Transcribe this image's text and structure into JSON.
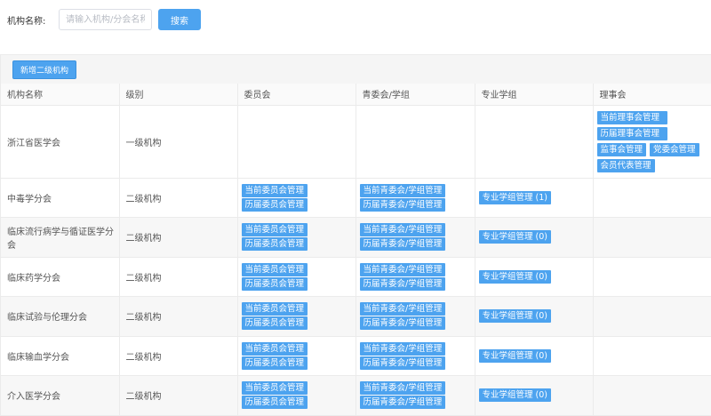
{
  "search": {
    "label": "机构名称:",
    "placeholder": "请输入机构/分会名称",
    "button": "搜索"
  },
  "toolbar": {
    "add_label": "新增二级机构"
  },
  "table": {
    "headers": [
      "机构名称",
      "级别",
      "委员会",
      "青委会/学组",
      "专业学组",
      "理事会"
    ],
    "top_row": {
      "name": "浙江省医学会",
      "level": "一级机构",
      "council_buttons": [
        "当前理事会管理",
        "历届理事会管理",
        "监事会管理",
        "党委会管理",
        "会员代表管理"
      ]
    },
    "rows": [
      {
        "name": "中毒学分会",
        "level": "二级机构",
        "committee": [
          "当前委员会管理",
          "历届委员会管理"
        ],
        "youth": [
          "当前青委会/学组管理",
          "历届青委会/学组管理"
        ],
        "group": "专业学组管理 (1)"
      },
      {
        "name": "临床流行病学与循证医学分会",
        "level": "二级机构",
        "committee": [
          "当前委员会管理",
          "历届委员会管理"
        ],
        "youth": [
          "当前青委会/学组管理",
          "历届青委会/学组管理"
        ],
        "group": "专业学组管理 (0)"
      },
      {
        "name": "临床药学分会",
        "level": "二级机构",
        "committee": [
          "当前委员会管理",
          "历届委员会管理"
        ],
        "youth": [
          "当前青委会/学组管理",
          "历届青委会/学组管理"
        ],
        "group": "专业学组管理 (0)"
      },
      {
        "name": "临床试验与伦理分会",
        "level": "二级机构",
        "committee": [
          "当前委员会管理",
          "历届委员会管理"
        ],
        "youth": [
          "当前青委会/学组管理",
          "历届青委会/学组管理"
        ],
        "group": "专业学组管理 (0)"
      },
      {
        "name": "临床输血学分会",
        "level": "二级机构",
        "committee": [
          "当前委员会管理",
          "历届委员会管理"
        ],
        "youth": [
          "当前青委会/学组管理",
          "历届青委会/学组管理"
        ],
        "group": "专业学组管理 (0)"
      },
      {
        "name": "介入医学分会",
        "level": "二级机构",
        "committee": [
          "当前委员会管理",
          "历届委员会管理"
        ],
        "youth": [
          "当前青委会/学组管理",
          "历届青委会/学组管理"
        ],
        "group": "专业学组管理 (0)"
      }
    ]
  },
  "colors": {
    "accent": "#4da3ef",
    "border": "#ebebeb",
    "stripe": "#f7f7f7"
  }
}
